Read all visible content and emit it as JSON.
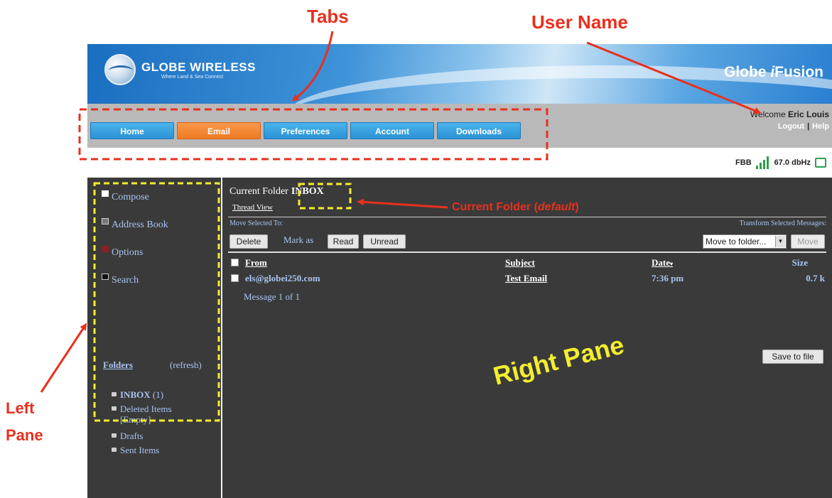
{
  "annotations": {
    "tabs": "Tabs",
    "user_name": "User Name",
    "left_pane_line1": "Left",
    "left_pane_line2": "Pane",
    "current_folder": "Current Folder (",
    "current_folder_italic": "default",
    "current_folder_end": ")",
    "right_pane": "Right Pane",
    "color_red": "#e8301e",
    "color_yellow": "#f3ee2d"
  },
  "banner": {
    "logo_title": "GLOBE WIRELESS",
    "logo_sub": "Where Land & Sea Connect",
    "logo_icon": "globe-icon",
    "brand_prefix": "Globe ",
    "brand_italic": "i",
    "brand_suffix": "Fusion"
  },
  "nav": {
    "tabs": [
      "Home",
      "Email",
      "Preferences",
      "Account",
      "Downloads"
    ],
    "active_tab": "Email",
    "accent_color": "#2b93d6",
    "active_color": "#ef7a22"
  },
  "user": {
    "welcome_prefix": "Welcome ",
    "name": "Eric Louis",
    "logout": "Logout",
    "separator": "|",
    "help": "Help"
  },
  "status": {
    "connection": "FBB",
    "signal_icon": "signal-bars-icon",
    "signal_strength": "67.0 dbHz",
    "status_icon": "screen-icon"
  },
  "left_pane": {
    "actions": [
      {
        "label": "Compose",
        "icon": "compose-icon"
      },
      {
        "label": "Address Book",
        "icon": "address-book-icon"
      },
      {
        "label": "Options",
        "icon": "options-icon"
      },
      {
        "label": "Search",
        "icon": "search-icon"
      }
    ],
    "folders_header": "Folders",
    "refresh": "(refresh)",
    "folders": [
      {
        "name": "INBOX",
        "count": "(1)"
      },
      {
        "name": "Deleted Items [Empty]",
        "count": ""
      },
      {
        "name": "Drafts",
        "count": ""
      },
      {
        "name": "Sent Items",
        "count": ""
      }
    ]
  },
  "right_pane": {
    "current_folder_label": "Current Folder",
    "current_folder": "INBOX",
    "thread_view": "Thread View",
    "move_selected_to": "Move Selected To:",
    "transform_selected": "Transform Selected Messages:",
    "delete": "Delete",
    "mark_as": "Mark as",
    "read": "Read",
    "unread": "Unread",
    "move_select_value": "Move to folder...",
    "move_button": "Move",
    "columns": {
      "from": "From",
      "subject": "Subject",
      "date": "Date",
      "size": "Size"
    },
    "messages": [
      {
        "from": "els@globei250.com",
        "subject": "Test Email",
        "date": "7:36 pm",
        "size": "0.7 k"
      }
    ],
    "message_count": "Message 1 of 1",
    "save_to_file": "Save to file"
  }
}
